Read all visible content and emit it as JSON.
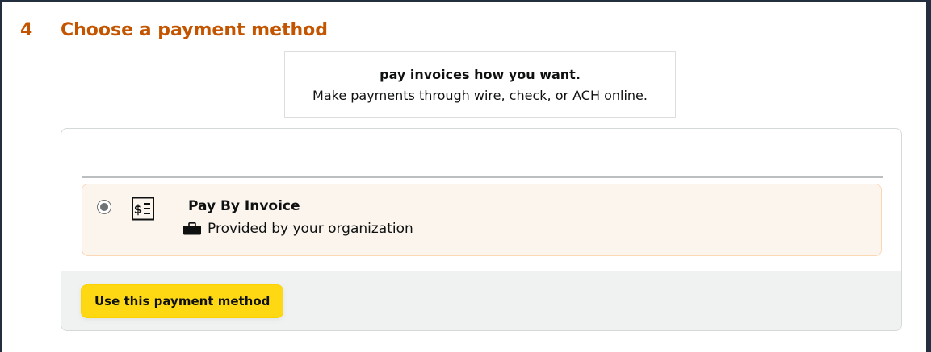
{
  "step": {
    "number": "4",
    "title": "Choose a payment method"
  },
  "promo": {
    "title": "pay invoices how you want.",
    "subtitle": "Make payments through wire, check, or ACH online."
  },
  "payment_option": {
    "icon": "invoice-icon",
    "title": "Pay By Invoice",
    "subtitle_icon": "briefcase-icon",
    "subtitle": "Provided by your organization",
    "selected": true
  },
  "footer": {
    "button_label": "Use this payment method"
  },
  "colors": {
    "step_header": "#c45500",
    "option_background": "#fcf5ee",
    "option_border": "#fbd8b4",
    "button_background": "#ffd814",
    "footer_background": "#f0f2f2",
    "outer_background": "#232f3e"
  }
}
